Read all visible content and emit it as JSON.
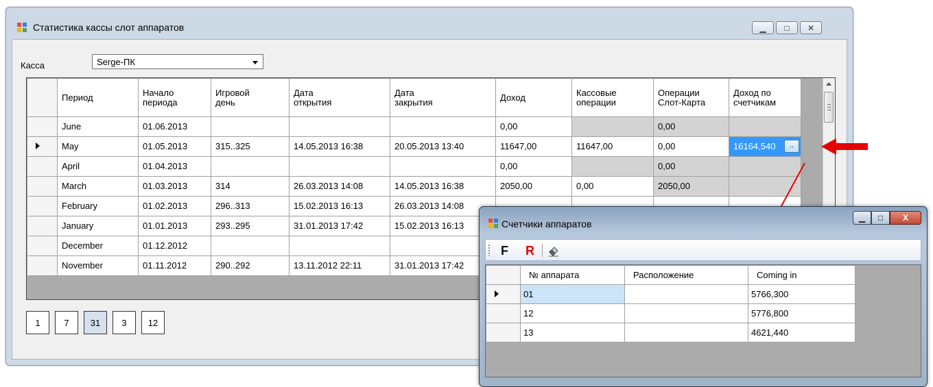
{
  "main_window": {
    "title": "Статистика кассы слот аппаратов",
    "kassa_label": "Касса",
    "kassa_value": "Serge-ПК",
    "columns": [
      "Период",
      "Начало\nпериода",
      "Игровой\nдень",
      "Дата\nоткрытия",
      "Дата\nзакрытия",
      "Доход",
      "Кассовые\nоперации",
      "Операции\nСлот-Карта",
      "Доход по\nсчетчикам"
    ],
    "rows": [
      [
        "June",
        "01.06.2013",
        "",
        "",
        "",
        "0,00",
        "",
        "0,00",
        ""
      ],
      [
        "May",
        "01.05.2013",
        "315..325",
        "14.05.2013 16:38",
        "20.05.2013 13:40",
        "11647,00",
        "11647,00",
        "0,00",
        "16164,540"
      ],
      [
        "April",
        "01.04.2013",
        "",
        "",
        "",
        "0,00",
        "",
        "0,00",
        ""
      ],
      [
        "March",
        "01.03.2013",
        "314",
        "26.03.2013 14:08",
        "14.05.2013 16:38",
        "2050,00",
        "0,00",
        "2050,00",
        ""
      ],
      [
        "February",
        "01.02.2013",
        "296..313",
        "15.02.2013 16:13",
        "26.03.2013 14:08",
        "",
        "",
        "",
        ""
      ],
      [
        "January",
        "01.01.2013",
        "293..295",
        "31.01.2013 17:42",
        "15.02.2013 16:13",
        "",
        "",
        "",
        ""
      ],
      [
        "December",
        "01.12.2012",
        "",
        "",
        "",
        "",
        "",
        "",
        ""
      ],
      [
        "November",
        "01.11.2012",
        "290..292",
        "13.11.2012 22:11",
        "31.01.2013 17:42",
        "",
        "",
        "",
        ""
      ]
    ],
    "ellipsis": "..",
    "pager": [
      "1",
      "7",
      "31",
      "3",
      "12"
    ]
  },
  "counters_window": {
    "title": "Счетчики аппаратов",
    "toolbar": {
      "f": "F",
      "r": "R"
    },
    "columns": [
      "№ аппарата",
      "Расположение",
      "Coming in"
    ],
    "rows": [
      [
        "01",
        "",
        "5766,300"
      ],
      [
        "12",
        "",
        "5776,800"
      ],
      [
        "13",
        "",
        "4621,440"
      ]
    ]
  },
  "colors": {
    "accent_red": "#e60000",
    "selection": "#3399ff"
  }
}
